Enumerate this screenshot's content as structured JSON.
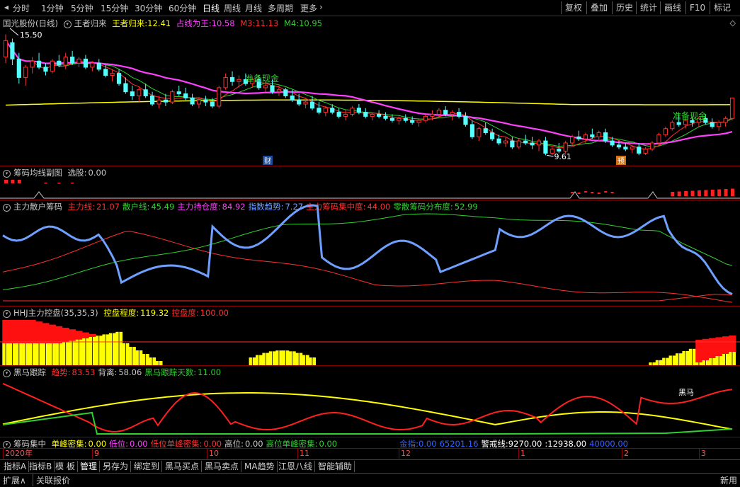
{
  "toolbar": {
    "periods": [
      "分时",
      "1分钟",
      "5分钟",
      "15分钟",
      "30分钟",
      "60分钟",
      "日线",
      "周线",
      "月线",
      "多周期",
      "更多"
    ],
    "active_period": "日线",
    "right_buttons": [
      "复权",
      "叠加",
      "历史",
      "统计",
      "画线",
      "F10",
      "标记"
    ]
  },
  "main_panel": {
    "stock": "国光股份",
    "period_label": "(日线)",
    "indicator": "王者归来",
    "ind1_label": "王者归来:",
    "ind1_value": "12.41",
    "ind2_label": "占线为王:",
    "ind2_value": "10.58",
    "ind3_label": "M3:",
    "ind3_value": "11.13",
    "ind4_label": "M4:",
    "ind4_value": "10.95",
    "high_label": "15.50",
    "low_label": "9.61",
    "annotation1": "准备现金",
    "annotation2": "准备现金",
    "badge1": "财",
    "badge2": "预"
  },
  "panel2": {
    "name": "筹码均线副图",
    "label": "选股:",
    "value": "0.00"
  },
  "panel3": {
    "name": "主力散户筹码",
    "items": [
      {
        "label": "主力线:",
        "value": "21.07",
        "color": "#ff3030"
      },
      {
        "label": "散户线:",
        "value": "45.49",
        "color": "#30d030"
      },
      {
        "label": "主力持仓度:",
        "value": "84.92",
        "color": "#ff40ff"
      },
      {
        "label": "指数趋势:",
        "value": "7.27",
        "color": "#6fa0ff"
      },
      {
        "label": "主力筹码集中度:",
        "value": "44.00",
        "color": "#ff3030"
      },
      {
        "label": "零散筹码分布度:",
        "value": "52.99",
        "color": "#30d030"
      }
    ]
  },
  "panel4": {
    "name": "HHJ主力控盘(35,35,3)",
    "items": [
      {
        "label": "控盘程度:",
        "value": "119.32",
        "color": "#ffff00"
      },
      {
        "label": "控盘度:",
        "value": "100.00",
        "color": "#ff3030"
      }
    ]
  },
  "panel5": {
    "name": "黑马跟踪",
    "items": [
      {
        "label": "趋势:",
        "value": "83.53",
        "color": "#ff3030"
      },
      {
        "label": "背离:",
        "value": "58.06",
        "color": "#c8c8c8"
      },
      {
        "label": "黑马跟踪天数:",
        "value": "11.00",
        "color": "#30d030"
      }
    ],
    "annotation": "黑马"
  },
  "panel6": {
    "name": "筹码集中",
    "items": [
      {
        "label": "单峰密集:",
        "value": "0.00",
        "color": "#ffff00"
      },
      {
        "label": "低位:",
        "value": "0.00",
        "color": "#ff40ff"
      },
      {
        "label": "低位单峰密集:",
        "value": "0.00",
        "color": "#ff3030"
      },
      {
        "label": "高位:",
        "value": "0.00",
        "color": "#c8c8c8"
      },
      {
        "label": "高位单峰密集:",
        "value": "0.00",
        "color": "#30d030"
      }
    ],
    "items2": [
      {
        "label": "金指:",
        "value": "0.00",
        "color": "#3060ff"
      },
      {
        "label": "",
        "value": "65201.16",
        "color": "#3060ff"
      },
      {
        "label": "警戒线:",
        "value": "9270.00",
        "color": "#ffffff"
      },
      {
        "label": ":",
        "value": "12938.00",
        "color": "#ffffff"
      },
      {
        "label": "",
        "value": "40000.00",
        "color": "#3060ff"
      }
    ]
  },
  "date_axis": [
    "2020年",
    "9",
    "10",
    "11",
    "12",
    "1",
    "2",
    "3"
  ],
  "bottom_tabs": [
    "指标A",
    "指标B",
    "模 板",
    "管理",
    "另存为",
    "绑定到",
    "黑马买点",
    "黑马卖点",
    "MA趋势",
    "江恩八线",
    "智能辅助"
  ],
  "status_left": [
    "扩展∧",
    "关联报价"
  ],
  "status_right": "新用",
  "colors": {
    "up": "#ff3030",
    "down": "#54ffff",
    "ma_magenta": "#ff40ff",
    "ma_yellow": "#ffff00",
    "grid": "#8b0000"
  },
  "chart_data": [
    {
      "type": "candlestick",
      "title": "国光股份 (日线)",
      "ylim": [
        9.3,
        15.8
      ],
      "ohlc": [
        [
          14.4,
          15.5,
          14.1,
          15.2
        ],
        [
          15.1,
          15.3,
          14.0,
          14.3
        ],
        [
          14.3,
          14.6,
          13.1,
          13.4
        ],
        [
          13.4,
          14.0,
          13.0,
          13.9
        ],
        [
          13.9,
          14.4,
          13.6,
          14.2
        ],
        [
          14.2,
          14.6,
          13.8,
          13.9
        ],
        [
          13.9,
          14.1,
          13.5,
          13.7
        ],
        [
          13.7,
          14.3,
          13.6,
          14.2
        ],
        [
          14.2,
          14.5,
          13.9,
          14.0
        ],
        [
          14.0,
          14.6,
          13.8,
          14.4
        ],
        [
          14.4,
          14.7,
          14.0,
          14.1
        ],
        [
          14.1,
          14.4,
          13.9,
          14.3
        ],
        [
          14.3,
          14.5,
          13.8,
          13.9
        ],
        [
          13.9,
          14.2,
          13.7,
          14.1
        ],
        [
          14.1,
          14.3,
          13.7,
          13.8
        ],
        [
          13.8,
          14.0,
          13.4,
          13.5
        ],
        [
          13.5,
          13.8,
          13.2,
          13.6
        ],
        [
          13.6,
          13.8,
          13.0,
          13.1
        ],
        [
          13.1,
          13.4,
          12.6,
          12.7
        ],
        [
          12.7,
          13.0,
          12.3,
          12.5
        ],
        [
          12.5,
          12.9,
          12.2,
          12.8
        ],
        [
          12.8,
          13.1,
          12.4,
          12.5
        ],
        [
          12.5,
          12.7,
          12.0,
          12.1
        ],
        [
          12.1,
          12.5,
          11.9,
          12.3
        ],
        [
          12.3,
          12.6,
          12.0,
          12.2
        ],
        [
          12.2,
          12.8,
          12.1,
          12.7
        ],
        [
          12.7,
          13.0,
          12.5,
          12.6
        ],
        [
          12.6,
          12.9,
          12.3,
          12.4
        ],
        [
          12.4,
          12.6,
          12.0,
          12.1
        ],
        [
          12.1,
          12.4,
          11.9,
          12.3
        ],
        [
          12.3,
          12.5,
          12.0,
          12.2
        ],
        [
          12.2,
          12.4,
          11.9,
          12.0
        ],
        [
          12.0,
          13.0,
          11.9,
          12.9
        ],
        [
          12.9,
          13.6,
          12.8,
          13.4
        ],
        [
          13.4,
          13.7,
          13.0,
          13.2
        ],
        [
          13.2,
          13.5,
          12.9,
          13.3
        ],
        [
          13.3,
          13.6,
          13.0,
          13.1
        ],
        [
          13.1,
          13.4,
          12.9,
          13.3
        ],
        [
          13.3,
          13.5,
          12.8,
          12.9
        ],
        [
          12.9,
          13.2,
          12.7,
          13.0
        ],
        [
          13.0,
          13.3,
          12.6,
          12.7
        ],
        [
          12.7,
          13.0,
          12.5,
          12.8
        ],
        [
          12.8,
          12.9,
          12.4,
          12.5
        ],
        [
          12.5,
          12.8,
          12.2,
          12.3
        ],
        [
          12.3,
          12.6,
          12.0,
          12.1
        ],
        [
          12.1,
          12.4,
          11.9,
          12.2
        ],
        [
          12.2,
          12.5,
          11.8,
          11.9
        ],
        [
          11.9,
          12.2,
          11.6,
          11.7
        ],
        [
          11.7,
          12.0,
          11.5,
          11.9
        ],
        [
          11.9,
          12.1,
          11.6,
          11.7
        ],
        [
          11.7,
          11.9,
          11.4,
          11.5
        ],
        [
          11.5,
          11.8,
          11.3,
          11.6
        ],
        [
          11.6,
          12.0,
          11.5,
          11.9
        ],
        [
          11.9,
          12.1,
          11.6,
          11.7
        ],
        [
          11.7,
          11.9,
          11.4,
          11.5
        ],
        [
          11.5,
          11.7,
          11.3,
          11.6
        ],
        [
          11.6,
          11.8,
          11.4,
          11.5
        ],
        [
          11.5,
          11.7,
          11.3,
          11.4
        ],
        [
          11.4,
          11.6,
          11.2,
          11.3
        ],
        [
          11.3,
          11.5,
          11.1,
          11.4
        ],
        [
          11.4,
          11.6,
          11.2,
          11.3
        ],
        [
          11.3,
          11.5,
          11.1,
          11.2
        ],
        [
          11.2,
          11.4,
          11.0,
          11.3
        ],
        [
          11.3,
          11.6,
          11.2,
          11.5
        ],
        [
          11.5,
          11.8,
          11.3,
          11.6
        ],
        [
          11.6,
          11.9,
          11.4,
          11.8
        ],
        [
          11.8,
          12.0,
          11.5,
          11.6
        ],
        [
          11.6,
          11.8,
          11.3,
          11.7
        ],
        [
          11.7,
          11.9,
          11.4,
          11.5
        ],
        [
          11.5,
          11.7,
          11.0,
          11.1
        ],
        [
          11.1,
          11.3,
          10.4,
          10.5
        ],
        [
          10.5,
          11.0,
          10.3,
          10.9
        ],
        [
          10.9,
          11.2,
          10.6,
          10.7
        ],
        [
          10.7,
          10.9,
          10.3,
          10.4
        ],
        [
          10.4,
          10.6,
          10.1,
          10.2
        ],
        [
          10.2,
          10.5,
          10.0,
          10.3
        ],
        [
          10.3,
          10.5,
          9.9,
          10.0
        ],
        [
          10.0,
          10.4,
          9.9,
          10.3
        ],
        [
          10.3,
          10.6,
          10.1,
          10.2
        ],
        [
          10.2,
          10.5,
          9.9,
          10.1
        ],
        [
          10.1,
          10.4,
          9.8,
          10.3
        ],
        [
          10.3,
          10.5,
          9.6,
          9.7
        ],
        [
          9.7,
          10.0,
          9.6,
          9.9
        ],
        [
          9.9,
          10.2,
          9.7,
          9.8
        ],
        [
          9.8,
          10.3,
          9.7,
          10.2
        ],
        [
          10.2,
          10.6,
          10.1,
          10.5
        ],
        [
          10.5,
          10.8,
          10.3,
          10.4
        ],
        [
          10.4,
          10.7,
          10.2,
          10.6
        ],
        [
          10.6,
          10.9,
          10.4,
          10.5
        ],
        [
          10.5,
          10.8,
          10.3,
          10.7
        ],
        [
          10.7,
          10.9,
          10.2,
          10.3
        ],
        [
          10.3,
          10.5,
          10.0,
          10.1
        ],
        [
          10.1,
          10.3,
          9.9,
          10.0
        ],
        [
          10.0,
          10.2,
          9.8,
          9.9
        ],
        [
          9.9,
          10.1,
          9.7,
          10.0
        ],
        [
          10.0,
          10.2,
          9.6,
          9.7
        ],
        [
          9.7,
          10.0,
          9.61,
          9.9
        ],
        [
          9.9,
          10.3,
          9.8,
          10.2
        ],
        [
          10.2,
          10.7,
          10.1,
          10.6
        ],
        [
          10.6,
          11.0,
          10.5,
          10.9
        ],
        [
          10.9,
          11.3,
          10.8,
          11.2
        ],
        [
          11.2,
          11.6,
          11.0,
          11.1
        ],
        [
          11.1,
          11.4,
          10.9,
          11.3
        ],
        [
          11.3,
          11.5,
          11.0,
          11.2
        ],
        [
          11.2,
          11.5,
          11.0,
          11.4
        ],
        [
          11.4,
          11.6,
          11.1,
          11.2
        ],
        [
          11.2,
          11.4,
          10.9,
          11.0
        ],
        [
          11.0,
          11.3,
          10.8,
          11.2
        ],
        [
          11.2,
          11.5,
          11.0,
          11.4
        ],
        [
          11.4,
          12.4,
          11.3,
          12.4
        ]
      ]
    },
    {
      "type": "bar",
      "title": "筹码均线副图"
    },
    {
      "type": "line",
      "title": "主力散户筹码",
      "series": [
        {
          "name": "主力线"
        },
        {
          "name": "散户线"
        },
        {
          "name": "指数趋势"
        }
      ]
    },
    {
      "type": "bar",
      "title": "HHJ主力控盘",
      "series": [
        {
          "name": "控盘程度"
        },
        {
          "name": "控盘度"
        }
      ]
    },
    {
      "type": "line",
      "title": "黑马跟踪",
      "series": [
        {
          "name": "趋势"
        },
        {
          "name": "背离"
        },
        {
          "name": "黑马跟踪天数"
        }
      ]
    },
    {
      "type": "line",
      "title": "筹码集中"
    }
  ]
}
